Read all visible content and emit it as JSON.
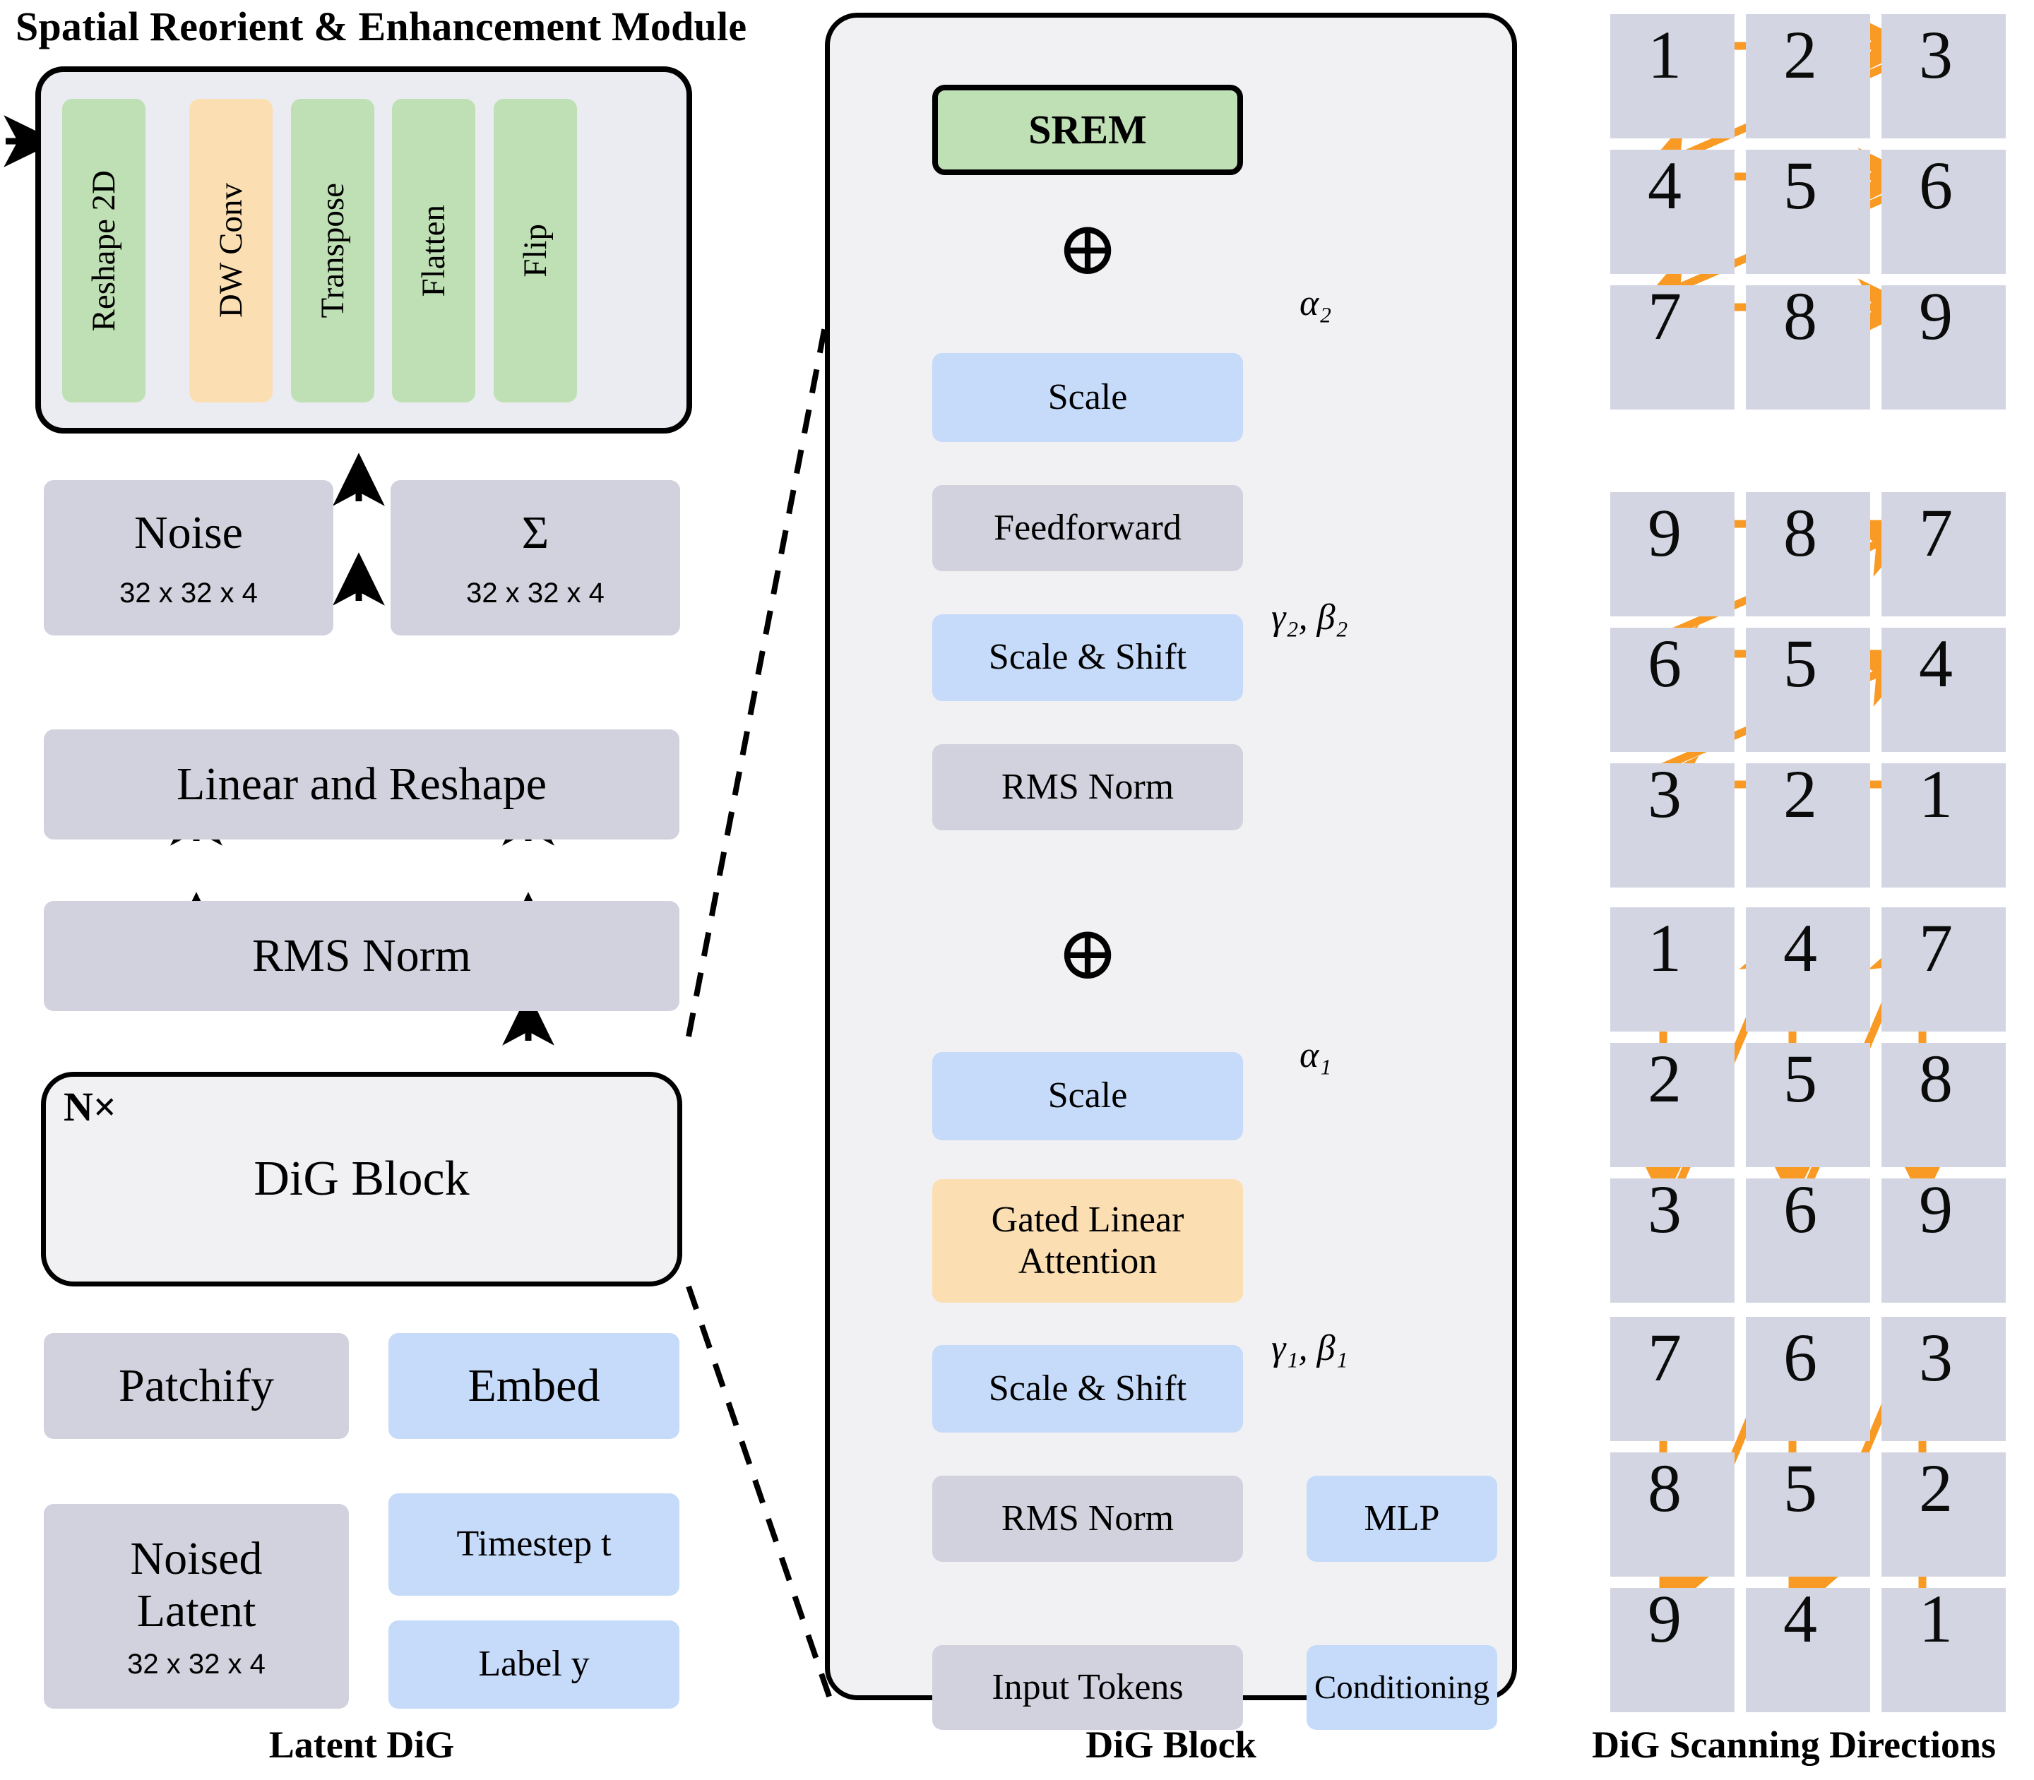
{
  "colors": {
    "green": "#bfe0b4",
    "orange_fill": "#fbdfb2",
    "blue": "#c6daf9",
    "gray": "#d1d2de",
    "panel_bg": "#f1f1f3",
    "srem_panel_bg": "#ebecf1",
    "grid_cell": "#d3d6e2",
    "arrow_orange": "#f89a24",
    "stroke": "#000000"
  },
  "srem_module": {
    "title": "Spatial Reorient & Enhancement Module",
    "stages": [
      {
        "label": "Reshape 2D",
        "color": "green"
      },
      {
        "label": "DW Conv",
        "color": "orange"
      },
      {
        "label": "Transpose",
        "color": "green"
      },
      {
        "label": "Flatten",
        "color": "green"
      },
      {
        "label": "Flip",
        "color": "green"
      }
    ]
  },
  "latent_dig": {
    "caption": "Latent DiG",
    "outputs": [
      {
        "label": "Noise",
        "shape": "32 x 32 x 4",
        "color": "gray"
      },
      {
        "label": "Σ",
        "shape": "32 x 32 x 4",
        "color": "gray"
      }
    ],
    "linear_reshape": {
      "label": "Linear and Reshape",
      "color": "gray"
    },
    "rms_norm": {
      "label": "RMS Norm",
      "color": "gray"
    },
    "dig_block": {
      "label": "DiG Block",
      "repeat": "N×"
    },
    "patchify": {
      "label": "Patchify",
      "color": "gray"
    },
    "embed": {
      "label": "Embed",
      "color": "blue"
    },
    "noised_latent": {
      "label1": "Noised",
      "label2": "Latent",
      "shape": "32 x 32 x 4",
      "color": "gray"
    },
    "timestep": {
      "label": "Timestep t",
      "color": "blue"
    },
    "label_y": {
      "label": "Label y",
      "color": "blue"
    }
  },
  "dig_block": {
    "caption": "DiG Block",
    "nodes": [
      {
        "id": "srem",
        "label": "SREM",
        "color": "green",
        "bordered": true
      },
      {
        "id": "scale2",
        "label": "Scale",
        "color": "blue"
      },
      {
        "id": "feedforward",
        "label": "Feedforward",
        "color": "gray"
      },
      {
        "id": "scale_shift2",
        "label": "Scale & Shift",
        "color": "blue"
      },
      {
        "id": "rms_norm2",
        "label": "RMS Norm",
        "color": "gray"
      },
      {
        "id": "scale1",
        "label": "Scale",
        "color": "blue"
      },
      {
        "id": "gla",
        "label1": "Gated Linear",
        "label2": "Attention",
        "color": "orange"
      },
      {
        "id": "scale_shift1",
        "label": "Scale & Shift",
        "color": "blue"
      },
      {
        "id": "rms_norm1",
        "label": "RMS Norm",
        "color": "gray"
      },
      {
        "id": "input_tokens",
        "label": "Input Tokens",
        "color": "gray"
      },
      {
        "id": "mlp",
        "label": "MLP",
        "color": "blue"
      },
      {
        "id": "conditioning",
        "label": "Conditioning",
        "color": "blue"
      }
    ],
    "modulation_labels": {
      "alpha2": "α₂",
      "gamma_beta2": "γ₂, β₂",
      "alpha1": "α₁",
      "gamma_beta1": "γ₁, β₁"
    },
    "add_symbol": "⊕"
  },
  "scanning_directions": {
    "caption": "DiG Scanning Directions",
    "grids": [
      {
        "name": "row-major-forward",
        "numbers": [
          [
            "1",
            "2",
            "3"
          ],
          [
            "4",
            "5",
            "6"
          ],
          [
            "7",
            "8",
            "9"
          ]
        ]
      },
      {
        "name": "row-major-reverse",
        "numbers": [
          [
            "9",
            "8",
            "7"
          ],
          [
            "6",
            "5",
            "4"
          ],
          [
            "3",
            "2",
            "1"
          ]
        ]
      },
      {
        "name": "column-major-forward",
        "numbers": [
          [
            "1",
            "4",
            "7"
          ],
          [
            "2",
            "5",
            "8"
          ],
          [
            "3",
            "6",
            "9"
          ]
        ]
      },
      {
        "name": "column-major-reverse",
        "numbers": [
          [
            "7",
            "6",
            "3"
          ],
          [
            "8",
            "5",
            "2"
          ],
          [
            "9",
            "4",
            "1"
          ]
        ]
      }
    ]
  }
}
